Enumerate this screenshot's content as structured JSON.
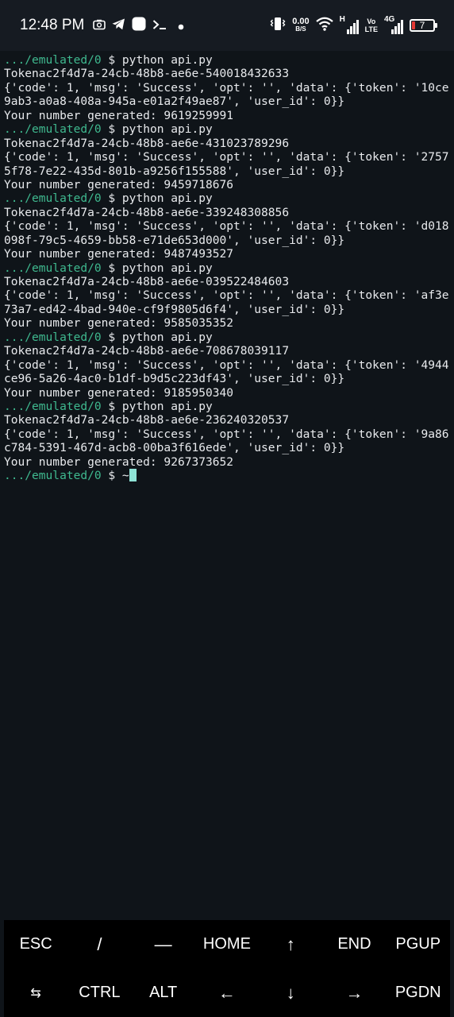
{
  "status_bar": {
    "time": "12:48 PM",
    "left_icons": [
      "screenshot-icon",
      "telegram-icon",
      "app-icon",
      "terminal-icon",
      "dot-icon"
    ],
    "net_speed_value": "0.00",
    "net_speed_unit": "B/S",
    "network_type_1": "H",
    "volte_top": "Vo",
    "volte_bottom": "LTE",
    "network_type_2": "4G",
    "battery_level": "7",
    "colors": {
      "battery_fill": "#e53935"
    }
  },
  "terminal": {
    "prompt_path": ".../emulated/0",
    "prompt_symbol": "$",
    "command": "python api.py",
    "runs": [
      {
        "token_line": "Tokenac2f4d7a-24cb-48b8-ae6e-540018432633",
        "response_line_1": "{'code': 1, 'msg': 'Success', 'opt': '', 'data': {'token': '10ce",
        "response_line_2": "9ab3-a0a8-408a-945a-e01a2f49ae87', 'user_id': 0}}",
        "number_line": "Your number generated: 9619259991"
      },
      {
        "token_line": "Tokenac2f4d7a-24cb-48b8-ae6e-431023789296",
        "response_line_1": "{'code': 1, 'msg': 'Success', 'opt': '', 'data': {'token': '2757",
        "response_line_2": "5f78-7e22-435d-801b-a9256f155588', 'user_id': 0}}",
        "number_line": "Your number generated: 9459718676"
      },
      {
        "token_line": "Tokenac2f4d7a-24cb-48b8-ae6e-339248308856",
        "response_line_1": "{'code': 1, 'msg': 'Success', 'opt': '', 'data': {'token': 'd018",
        "response_line_2": "098f-79c5-4659-bb58-e71de653d000', 'user_id': 0}}",
        "number_line": "Your number generated: 9487493527"
      },
      {
        "token_line": "Tokenac2f4d7a-24cb-48b8-ae6e-039522484603",
        "response_line_1": "{'code': 1, 'msg': 'Success', 'opt': '', 'data': {'token': 'af3e",
        "response_line_2": "73a7-ed42-4bad-940e-cf9f9805d6f4', 'user_id': 0}}",
        "number_line": "Your number generated: 9585035352"
      },
      {
        "token_line": "Tokenac2f4d7a-24cb-48b8-ae6e-708678039117",
        "response_line_1": "{'code': 1, 'msg': 'Success', 'opt': '', 'data': {'token': '4944",
        "response_line_2": "ce96-5a26-4ac0-b1df-b9d5c223df43', 'user_id': 0}}",
        "number_line": "Your number generated: 9185950340"
      },
      {
        "token_line": "Tokenac2f4d7a-24cb-48b8-ae6e-236240320537",
        "response_line_1": "{'code': 1, 'msg': 'Success', 'opt': '', 'data': {'token': '9a86",
        "response_line_2": "c784-5391-467d-acb8-00ba3f616ede', 'user_id': 0}}",
        "number_line": "Your number generated: 9267373652"
      }
    ],
    "final_prompt_tail": "~",
    "colors": {
      "background": "#0f1419",
      "text": "#e8eaed",
      "prompt_path": "#3fb98f",
      "cursor": "#8fe3d6"
    }
  },
  "extra_keys": {
    "row1": [
      "ESC",
      "/",
      "—",
      "HOME",
      "↑",
      "END",
      "PGUP"
    ],
    "row2": [
      "⇆",
      "CTRL",
      "ALT",
      "←",
      "↓",
      "→",
      "PGDN"
    ]
  }
}
